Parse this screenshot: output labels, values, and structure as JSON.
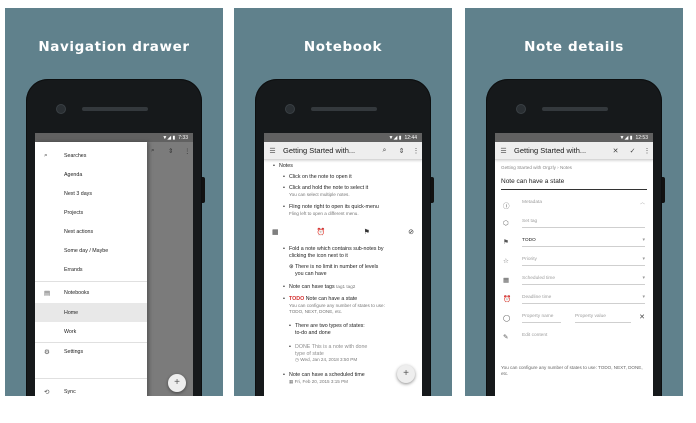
{
  "panels": [
    {
      "title": "Navigation drawer",
      "status_time": "7:33",
      "drawer_items": [
        "Searches",
        "Agenda",
        "Next 3 days",
        "Projects",
        "Next actions",
        "Some day / Maybe",
        "Errands",
        "Notebooks",
        "Home",
        "Work",
        "Settings",
        "Sync"
      ],
      "selected_item": "Home",
      "fab": "+"
    },
    {
      "title": "Notebook",
      "status_time": "12:44",
      "app_title": "Getting Started with...",
      "root": "Notes",
      "items": {
        "click": "Click on the note to open it",
        "hold": "Click and hold the note to select it",
        "hold_sub": "You can select multiple notes.",
        "fling": "Fling note right to open its quick-menu",
        "fling_sub": "Fling left to open a different menu.",
        "fold1": "Fold a note which contains sub-notes by",
        "fold2": "clicking the icon next to it",
        "limit1": "There is no limit in number of levels",
        "limit2": "you can have",
        "tags": "Note can have tags",
        "tags_val": "tag1 tag2",
        "todo_kw": "TODO",
        "state": "Note can have a state",
        "state_sub1": "You can configure any number of states to use:",
        "state_sub2": "TODO, NEXT, DONE, etc.",
        "two1": "There are two types of states:",
        "two2": "to-do and done",
        "done_kw": "DONE",
        "done_txt": "This is a note with done",
        "done_txt2": "type of state",
        "closed": "Wed, Jan 24, 2018 3:50 PM",
        "sched": "Note can have a scheduled time",
        "sched_val": "Fri, Feb 20, 2015 3:15 PM"
      },
      "fab": "+"
    },
    {
      "title": "Note details",
      "status_time": "12:53",
      "app_title": "Getting Started with...",
      "breadcrumb": "Getting Started with Orgzly › Notes",
      "note_title": "Note can have a state",
      "fields": {
        "metadata": "Metadata",
        "tags": "Set tag",
        "state": "TODO",
        "priority": "Priority",
        "scheduled": "Scheduled time",
        "deadline": "Deadline time",
        "prop_name": "Property name",
        "prop_value": "Property value",
        "edit": "Edit content"
      },
      "footer": "You can configure any number of states to use: TODO, NEXT, DONE, etc."
    }
  ],
  "icons": {
    "menu": "menu-icon",
    "search": "search-icon",
    "sort": "sort-icon",
    "more": "more-vert-icon"
  }
}
